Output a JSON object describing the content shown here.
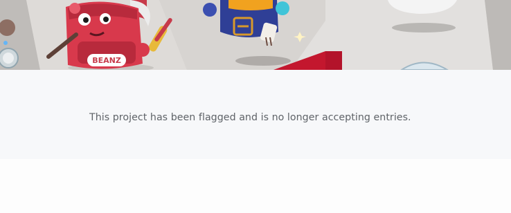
{
  "hero": {
    "character_badge_text": "BEANZ"
  },
  "notice": {
    "message": "This project has been flagged and is no longer accepting entries."
  }
}
